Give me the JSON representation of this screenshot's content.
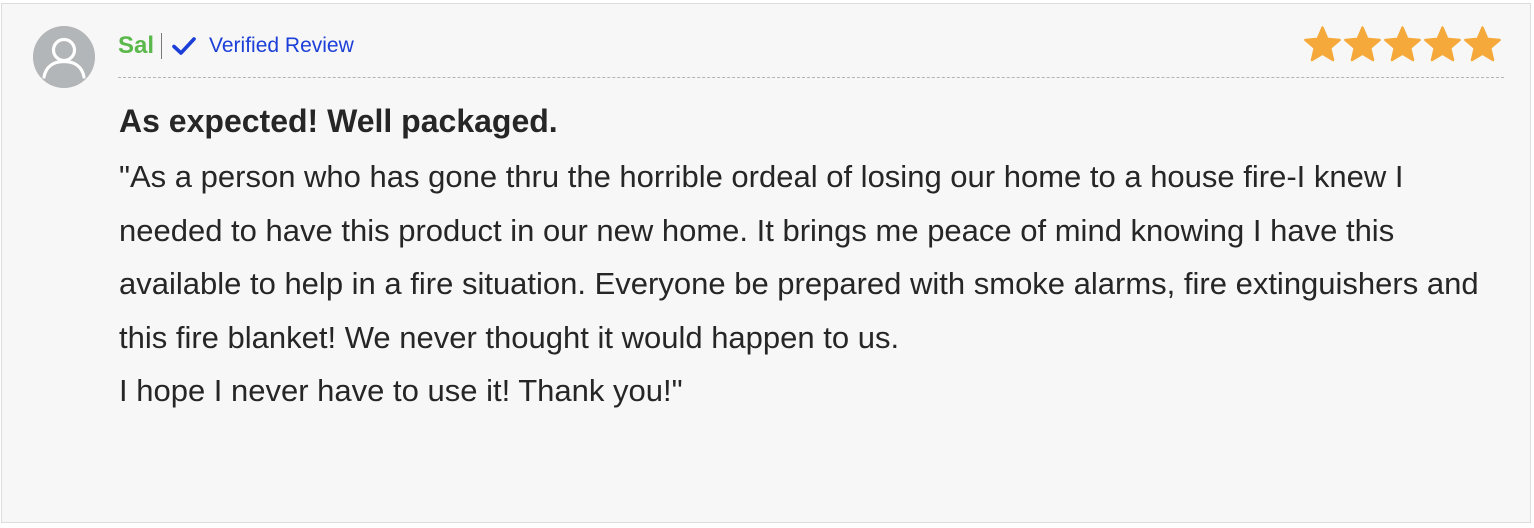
{
  "review": {
    "reviewer_name": "Sal",
    "verified_label": "Verified Review",
    "rating": 5,
    "rating_max": 5,
    "title": "As expected! Well packaged.",
    "body_paragraph_1": "\"As a person who has gone thru the horrible ordeal of losing our home to a house fire-I knew I needed to have this product in our new home. It brings me peace of mind knowing I have this available to help in a fire situation. Everyone be prepared with smoke alarms, fire extinguishers and this fire blanket! We never thought it would happen to us.",
    "body_paragraph_2": "I hope I never have to use it! Thank you!\""
  },
  "icons": {
    "avatar": "user-avatar-icon",
    "verified": "checkmark-icon",
    "star": "star-icon"
  },
  "colors": {
    "reviewer_name": "#5bb84a",
    "verified": "#1b3fd8",
    "star": "#f5a93a",
    "avatar_bg": "#b3b6b8",
    "card_bg": "#f7f7f7",
    "text": "#262626"
  }
}
